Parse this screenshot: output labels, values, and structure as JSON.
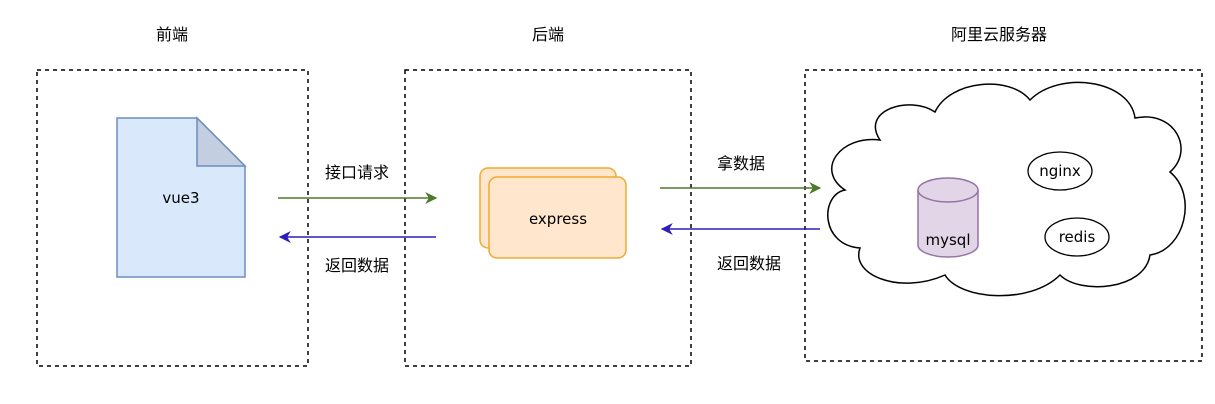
{
  "sections": {
    "frontend": {
      "title": "前端",
      "node": "vue3"
    },
    "backend": {
      "title": "后端",
      "node": "express"
    },
    "server": {
      "title": "阿里云服务器",
      "nodes": {
        "mysql": "mysql",
        "nginx": "nginx",
        "redis": "redis"
      }
    }
  },
  "edges": {
    "frontend_to_backend": {
      "label": "接口请求",
      "color": "#4d7a2a"
    },
    "backend_to_frontend": {
      "label": "返回数据",
      "color": "#2d1dbd"
    },
    "backend_to_server": {
      "label": "拿数据",
      "color": "#4d7a2a"
    },
    "server_to_backend": {
      "label": "返回数据",
      "color": "#2d1dbd"
    }
  },
  "colors": {
    "document_fill": "#dae8fc",
    "document_stroke": "#6c8ebf",
    "express_fill": "#ffe6cc",
    "express_stroke": "#f0a830",
    "mysql_fill": "#e1d5e7",
    "mysql_stroke": "#9673a6"
  }
}
